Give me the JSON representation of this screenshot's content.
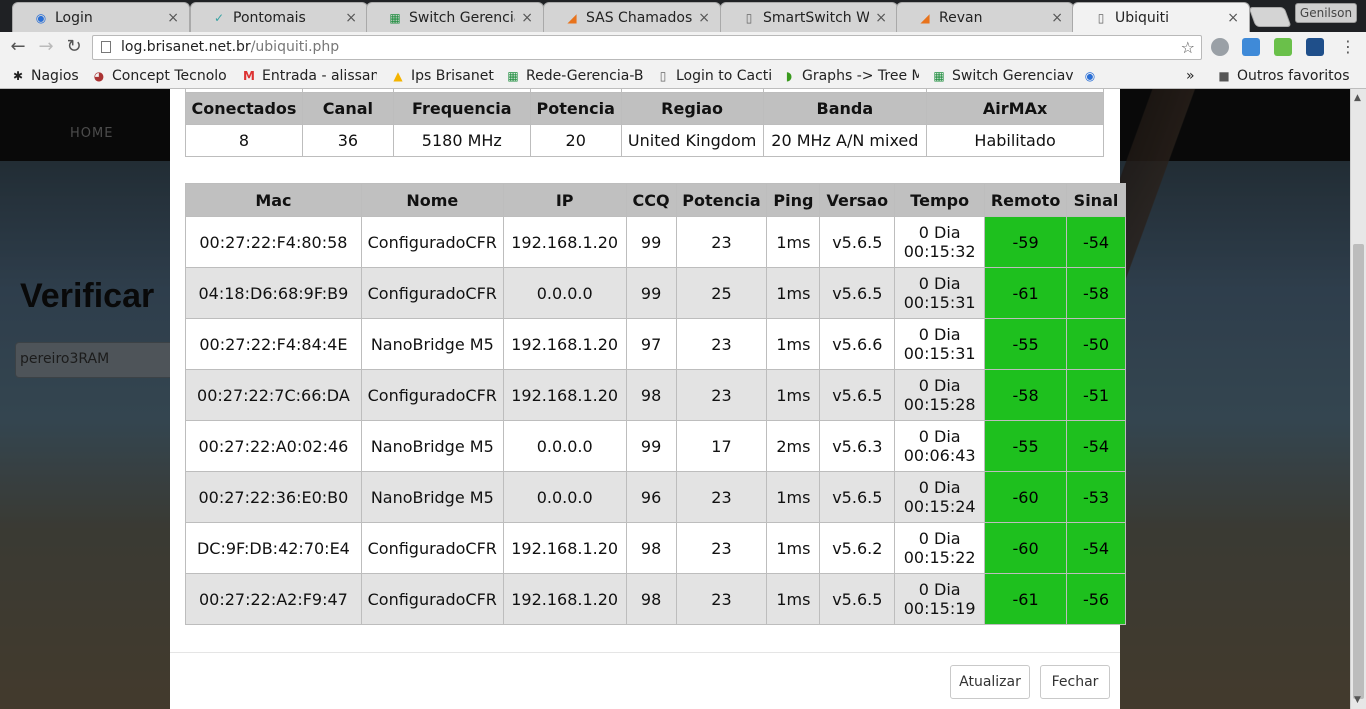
{
  "browser": {
    "tabs": [
      {
        "title": "Login",
        "icon": "rss-icon",
        "active": false
      },
      {
        "title": "Pontomais",
        "icon": "check-icon",
        "active": false
      },
      {
        "title": "Switch Gerenciav",
        "icon": "sheet-icon",
        "active": false
      },
      {
        "title": "SAS Chamados",
        "icon": "sas-icon",
        "active": false
      },
      {
        "title": "SmartSwitch We",
        "icon": "page-icon",
        "active": false
      },
      {
        "title": "Revan",
        "icon": "sas-icon",
        "active": false
      },
      {
        "title": "Ubiquiti",
        "icon": "page-icon",
        "active": true
      }
    ],
    "profile_name": "Genilson",
    "url_host": "log.brisanet.net.br",
    "url_path": "/ubiquiti.php",
    "bookmarks": [
      {
        "label": "Nagios",
        "icon": "nagios-icon"
      },
      {
        "label": "Concept Tecnolo",
        "icon": "concept-icon"
      },
      {
        "label": "Entrada - alissan",
        "icon": "gmail-icon"
      },
      {
        "label": "Ips Brisanet",
        "icon": "drive-icon"
      },
      {
        "label": "Rede-Gerencia-Br",
        "icon": "sheet-icon"
      },
      {
        "label": "Login to Cacti",
        "icon": "page-icon"
      },
      {
        "label": "Graphs -> Tree M",
        "icon": "cacti-icon"
      },
      {
        "label": "Switch Gerenciav",
        "icon": "sheet-icon"
      }
    ],
    "overflow": "»",
    "other_bookmarks": "Outros favoritos"
  },
  "page": {
    "nav_home": "HOME",
    "headline": "Verificar",
    "input_value": "pereiro3RAM"
  },
  "summary": {
    "headers": [
      "Conectados",
      "Canal",
      "Frequencia",
      "Potencia",
      "Regiao",
      "Banda",
      "AirMAx"
    ],
    "values": [
      "8",
      "36",
      "5180 MHz",
      "20",
      "United Kingdom",
      "20 MHz A/N mixed",
      "Habilitado"
    ]
  },
  "stations": {
    "headers": [
      "Mac",
      "Nome",
      "IP",
      "CCQ",
      "Potencia",
      "Ping",
      "Versao",
      "Tempo",
      "Remoto",
      "Sinal"
    ],
    "rows": [
      [
        "00:27:22:F4:80:58",
        "ConfiguradoCFR",
        "192.168.1.20",
        "99",
        "23",
        "1ms",
        "v5.6.5",
        "0 Dia",
        "00:15:32",
        "-59",
        "-54"
      ],
      [
        "04:18:D6:68:9F:B9",
        "ConfiguradoCFR",
        "0.0.0.0",
        "99",
        "25",
        "1ms",
        "v5.6.5",
        "0 Dia",
        "00:15:31",
        "-61",
        "-58"
      ],
      [
        "00:27:22:F4:84:4E",
        "NanoBridge M5",
        "192.168.1.20",
        "97",
        "23",
        "1ms",
        "v5.6.6",
        "0 Dia",
        "00:15:31",
        "-55",
        "-50"
      ],
      [
        "00:27:22:7C:66:DA",
        "ConfiguradoCFR",
        "192.168.1.20",
        "98",
        "23",
        "1ms",
        "v5.6.5",
        "0 Dia",
        "00:15:28",
        "-58",
        "-51"
      ],
      [
        "00:27:22:A0:02:46",
        "NanoBridge M5",
        "0.0.0.0",
        "99",
        "17",
        "2ms",
        "v5.6.3",
        "0 Dia",
        "00:06:43",
        "-55",
        "-54"
      ],
      [
        "00:27:22:36:E0:B0",
        "NanoBridge M5",
        "0.0.0.0",
        "96",
        "23",
        "1ms",
        "v5.6.5",
        "0 Dia",
        "00:15:24",
        "-60",
        "-53"
      ],
      [
        "DC:9F:DB:42:70:E4",
        "ConfiguradoCFR",
        "192.168.1.20",
        "98",
        "23",
        "1ms",
        "v5.6.2",
        "0 Dia",
        "00:15:22",
        "-60",
        "-54"
      ],
      [
        "00:27:22:A2:F9:47",
        "ConfiguradoCFR",
        "192.168.1.20",
        "98",
        "23",
        "1ms",
        "v5.6.5",
        "0 Dia",
        "00:15:19",
        "-61",
        "-56"
      ]
    ]
  },
  "footer": {
    "refresh_label": "Atualizar",
    "close_label": "Fechar"
  },
  "colors": {
    "signal_good": "#1ec01e",
    "header_gray": "#c0c0c0"
  }
}
